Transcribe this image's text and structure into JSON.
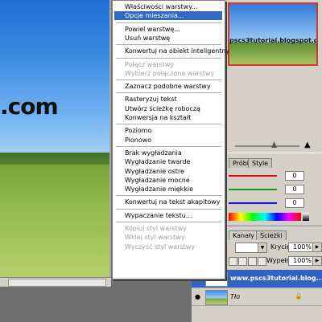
{
  "document": {
    "overlay_text": ".com",
    "colors": {
      "sky_top": "#1f6fd6",
      "field": "#93bb4c"
    }
  },
  "navigator": {
    "thumb_text": "pscs3tutorial.blogspot.com"
  },
  "color_panel": {
    "tabs": [
      "Próbki",
      "Style"
    ],
    "rows": [
      {
        "channel": "R",
        "value": "0",
        "color": "#e01010"
      },
      {
        "channel": "G",
        "value": "0",
        "color": "#10a010"
      },
      {
        "channel": "B",
        "value": "0",
        "color": "#1010e0"
      }
    ]
  },
  "layers_panel": {
    "tabs": [
      "Kanały",
      "Ścieżki"
    ],
    "opacity_label": "Krycie:",
    "opacity_value": "100%",
    "fill_label": "Wypełnij:",
    "fill_value": "100%",
    "layers": [
      {
        "name": "www.pscs3tutorial.blog...",
        "selected": true
      },
      {
        "name": "Tło",
        "selected": false
      }
    ]
  },
  "context_menu": {
    "items": [
      {
        "label": "Właściwości warstwy...",
        "disabled": false,
        "selected": false
      },
      {
        "label": "Opcje mieszania...",
        "disabled": false,
        "selected": true
      },
      {
        "sep": true
      },
      {
        "label": "Powiel warstwę...",
        "disabled": false,
        "selected": false
      },
      {
        "label": "Usuń warstwę",
        "disabled": false,
        "selected": false
      },
      {
        "sep": true
      },
      {
        "label": "Konwertuj na obiekt inteligentny",
        "disabled": false,
        "selected": false
      },
      {
        "sep": true
      },
      {
        "label": "Połącz warstwy",
        "disabled": true,
        "selected": false
      },
      {
        "label": "Wybierz połączone warstwy",
        "disabled": true,
        "selected": false
      },
      {
        "sep": true
      },
      {
        "label": "Zaznacz podobne warstwy",
        "disabled": false,
        "selected": false
      },
      {
        "sep": true
      },
      {
        "label": "Rasteryzuj tekst",
        "disabled": false,
        "selected": false
      },
      {
        "label": "Utwórz ścieżkę roboczą",
        "disabled": false,
        "selected": false
      },
      {
        "label": "Konwersja na kształt",
        "disabled": false,
        "selected": false
      },
      {
        "sep": true
      },
      {
        "label": "Poziomo",
        "disabled": false,
        "selected": false
      },
      {
        "label": "Pionowo",
        "disabled": false,
        "selected": false
      },
      {
        "sep": true
      },
      {
        "label": "Brak wygładzania",
        "disabled": false,
        "selected": false
      },
      {
        "label": "Wygładzanie twarde",
        "disabled": false,
        "selected": false
      },
      {
        "label": "Wygładzanie ostre",
        "disabled": false,
        "selected": false
      },
      {
        "label": "Wygładzanie mocne",
        "disabled": false,
        "selected": false
      },
      {
        "label": "Wygładzanie miękkie",
        "disabled": false,
        "selected": false
      },
      {
        "sep": true
      },
      {
        "label": "Konwertuj na tekst akapitowy",
        "disabled": false,
        "selected": false
      },
      {
        "sep": true
      },
      {
        "label": "Wypaczanie tekstu...",
        "disabled": false,
        "selected": false
      },
      {
        "sep": true
      },
      {
        "label": "Kopiuj styl warstwy",
        "disabled": true,
        "selected": false
      },
      {
        "label": "Wklej styl warstwy",
        "disabled": true,
        "selected": false
      },
      {
        "label": "Wyczyść styl warstwy",
        "disabled": true,
        "selected": false
      }
    ]
  }
}
